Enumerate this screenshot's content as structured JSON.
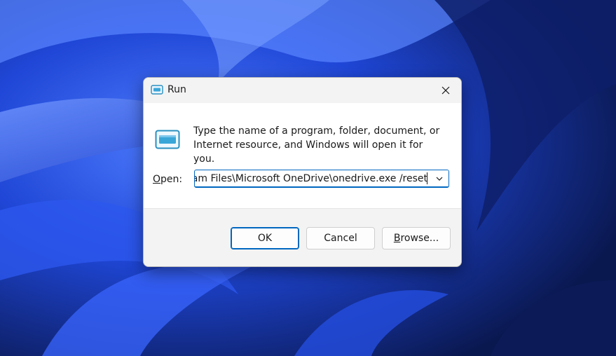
{
  "colors": {
    "accent": "#0067c0",
    "dialog_background": "#ffffff",
    "footer_background": "#f3f3f3",
    "wallpaper_dark": "#0a1850",
    "wallpaper_bright": "#3a6cff"
  },
  "desktop": {
    "wallpaper": "windows-11-bloom-wallpaper"
  },
  "dialog": {
    "title": "Run",
    "title_icon": "run-icon",
    "close_icon": "close-icon",
    "icon": "run-icon",
    "description_line1": "Type the name of a program, folder, document, or",
    "description_line2": "Internet resource, and Windows will open it for you.",
    "open_label_accesskey": "O",
    "open_label_rest": "pen:",
    "open_value": "ram Files\\Microsoft OneDrive\\onedrive.exe /reset",
    "dropdown_icon": "chevron-down-icon",
    "buttons": {
      "ok": "OK",
      "cancel": "Cancel",
      "browse_accesskey": "B",
      "browse_rest": "rowse..."
    }
  }
}
